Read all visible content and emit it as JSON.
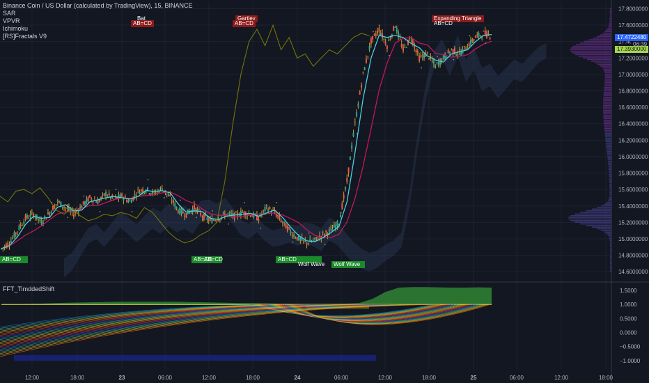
{
  "legend": {
    "symbol": "Binance Coin / US Dollar (calculated by TradingView), 15, BINANCE",
    "indicators": [
      "SAR",
      "VPVR",
      "Ichimoku",
      "[RS]Fractals V9"
    ]
  },
  "indicator_pane": {
    "title": "FFT_TimddedShift"
  },
  "price_tags": {
    "last": "17.4722480",
    "countdown": "06:39",
    "level": "17.3930000"
  },
  "patterns": [
    {
      "text": "Bat",
      "color": "red"
    },
    {
      "text": "AB=CD",
      "color": "red"
    },
    {
      "text": "Gartley",
      "color": "red"
    },
    {
      "text": "AB=CD",
      "color": "red"
    },
    {
      "text": "Expanding Triangle",
      "color": "red"
    },
    {
      "text": "AB=CD",
      "color": "red"
    },
    {
      "text": "AB=CD",
      "color": "green"
    },
    {
      "text": "AB=CD",
      "color": "green"
    },
    {
      "text": "AB=CD",
      "color": "green"
    },
    {
      "text": "AB=CD",
      "color": "green"
    },
    {
      "text": "Wolf Wave",
      "color": "green"
    },
    {
      "text": "Wolf Wave",
      "color": "green"
    }
  ],
  "colors": {
    "background": "#131722",
    "up": "#26a69a",
    "down": "#ef5350",
    "candle_body": "#c9a227",
    "tenkan": "#4dd0e1",
    "kijun": "#c2185b",
    "chikou": "#808000",
    "volume_profile": "#4a2a6a",
    "fft_area": "#2e7d32",
    "fft_blue": "#1a237e"
  },
  "chart_data": [
    {
      "type": "line",
      "title": "",
      "x_ticks": [
        "12:00",
        "18:00",
        "23",
        "06:00",
        "12:00",
        "18:00",
        "24",
        "06:00",
        "12:00",
        "18:00",
        "25",
        "06:00",
        "12:00",
        "18:00"
      ],
      "y_ticks": [
        14.6,
        14.8,
        15.0,
        15.2,
        15.4,
        15.6,
        15.8,
        16.0,
        16.2,
        16.4,
        16.6,
        16.8,
        17.0,
        17.2,
        17.4,
        17.6,
        17.8
      ],
      "ylim": [
        14.5,
        17.88
      ],
      "grid": true,
      "series": [
        {
          "name": "",
          "kind": "price",
          "values": [
            14.88,
            14.95,
            15.1,
            15.25,
            15.3,
            15.2,
            15.32,
            15.45,
            15.38,
            15.3,
            15.4,
            15.5,
            15.45,
            15.55,
            15.48,
            15.52,
            15.45,
            15.58,
            15.6,
            15.55,
            15.62,
            15.5,
            15.35,
            15.3,
            15.38,
            15.28,
            15.22,
            15.25,
            15.3,
            15.28,
            15.32,
            15.3,
            15.25,
            15.38,
            15.32,
            15.2,
            15.08,
            15.0,
            14.95,
            14.98,
            15.05,
            15.1,
            15.2,
            15.7,
            16.4,
            17.0,
            17.4,
            17.55,
            17.35,
            17.6,
            17.3,
            17.45,
            17.2,
            17.25,
            17.1,
            17.2,
            17.3,
            17.25,
            17.35,
            17.45,
            17.5,
            17.47
          ]
        }
      ]
    },
    {
      "type": "area",
      "title": "",
      "y_ticks": [
        1.5,
        1.0,
        0.5,
        0.0,
        -0.5,
        -1.0
      ],
      "ylim": [
        -1.3,
        1.75
      ],
      "series": [
        {
          "name": "",
          "values": [
            1.0,
            1.0,
            1.02,
            1.03,
            1.05,
            1.06,
            1.07,
            1.08,
            1.09,
            1.1,
            1.1,
            1.1,
            1.1,
            1.1,
            1.09,
            1.08,
            1.07,
            1.06,
            1.05,
            1.05,
            1.04,
            1.03,
            1.02,
            1.02,
            1.02,
            1.02,
            1.03,
            1.05,
            1.2,
            1.45,
            1.6,
            1.62,
            1.62,
            1.61,
            1.6,
            1.6,
            1.61,
            1.6
          ]
        }
      ]
    }
  ]
}
